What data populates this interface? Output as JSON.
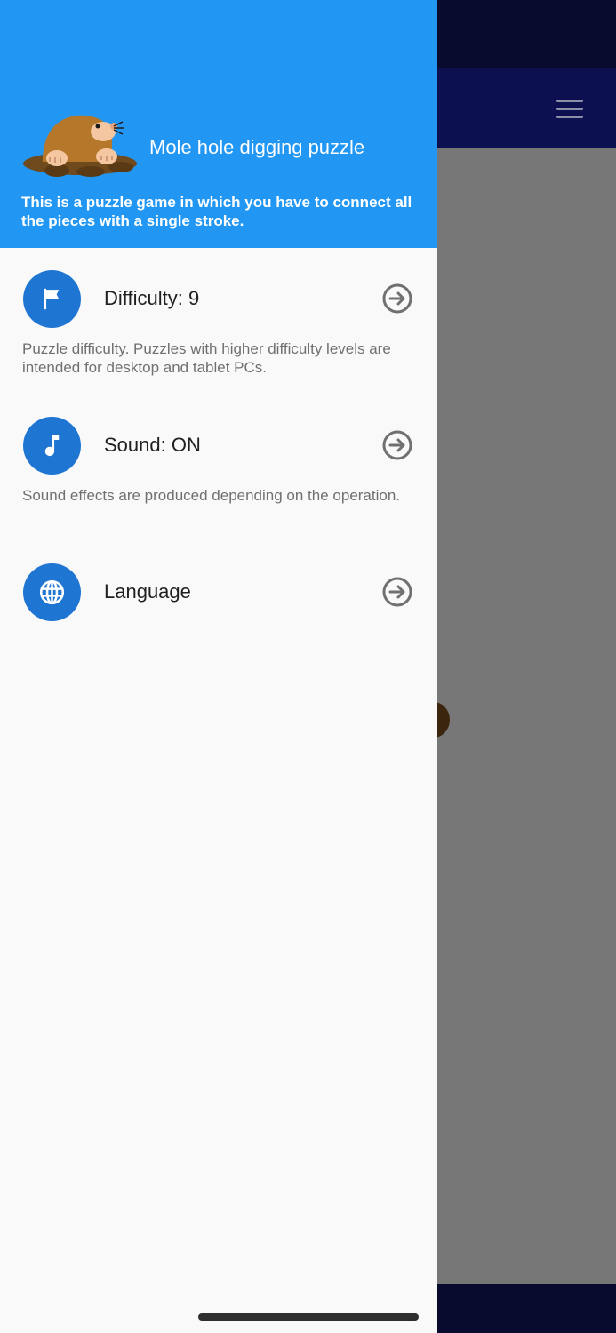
{
  "header": {
    "title": "Mole hole digging puzzle",
    "description": "This is a puzzle game in which you have to connect all the pieces with a single stroke."
  },
  "menu": {
    "items": [
      {
        "icon": "flag-icon",
        "label": "Difficulty: 9",
        "description": "Puzzle difficulty. Puzzles with higher difficulty levels are intended for desktop and tablet PCs."
      },
      {
        "icon": "music-note-icon",
        "label": "Sound: ON",
        "description": "Sound effects are produced depending on the operation."
      },
      {
        "icon": "globe-icon",
        "label": "Language",
        "description": ""
      }
    ]
  },
  "colors": {
    "header_bg": "#2196f3",
    "icon_circle": "#1e76d2",
    "drawer_bg": "#f9f9f9",
    "app_bar": "#0c1050",
    "scrim": "#777777"
  }
}
